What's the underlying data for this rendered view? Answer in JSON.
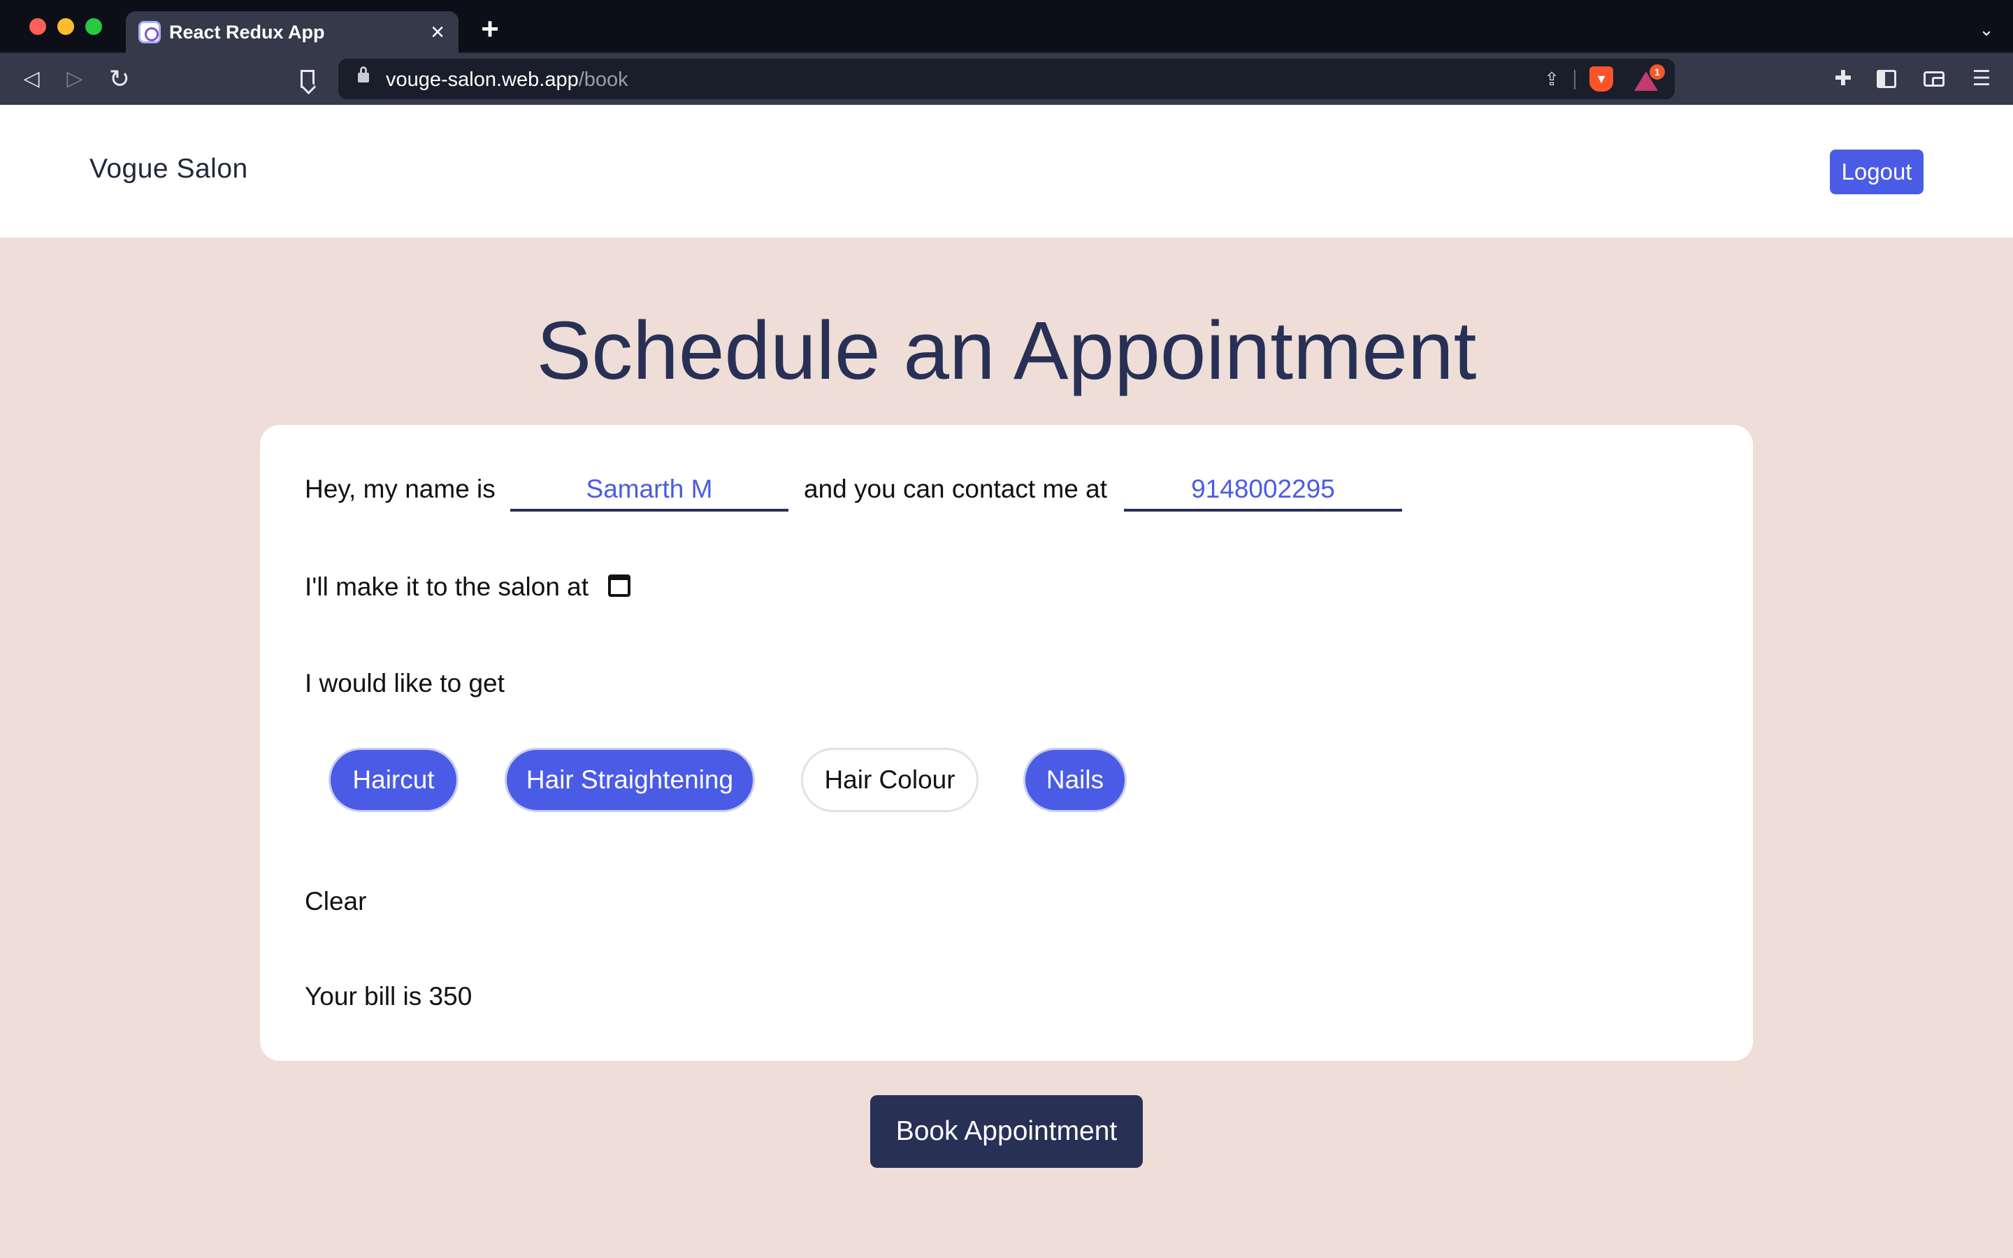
{
  "browser": {
    "tab_title": "React Redux App",
    "tab_close_glyph": "×",
    "new_tab_glyph": "+",
    "url_host": "vouge-salon.web.app",
    "url_path": "/book",
    "rewards_badge": "1",
    "icons": [
      "back-icon",
      "forward-icon",
      "reload-icon",
      "bookmark-icon",
      "lock-icon",
      "share-icon",
      "brave-shields-icon",
      "brave-rewards-icon",
      "extensions-icon",
      "sidebar-icon",
      "wallet-icon",
      "menu-icon"
    ]
  },
  "header": {
    "brand": "Vogue Salon",
    "logout_label": "Logout"
  },
  "main": {
    "title": "Schedule an Appointment",
    "intro_prefix": "Hey, my name is",
    "name_value": "Samarth M",
    "intro_middle": "and you can contact me at",
    "phone_value": "9148002295",
    "arrival_label": "I'll make it to the salon at",
    "services_label": "I would like to get",
    "services": [
      {
        "label": "Haircut",
        "selected": true
      },
      {
        "label": "Hair Straightening",
        "selected": true
      },
      {
        "label": "Hair Colour",
        "selected": false
      },
      {
        "label": "Nails",
        "selected": true
      }
    ],
    "clear_label": "Clear",
    "bill_text": "Your bill is 350",
    "book_label": "Book Appointment"
  },
  "colors": {
    "accent": "#4a5be6",
    "navy": "#283056",
    "page_bg": "#eeded7"
  }
}
